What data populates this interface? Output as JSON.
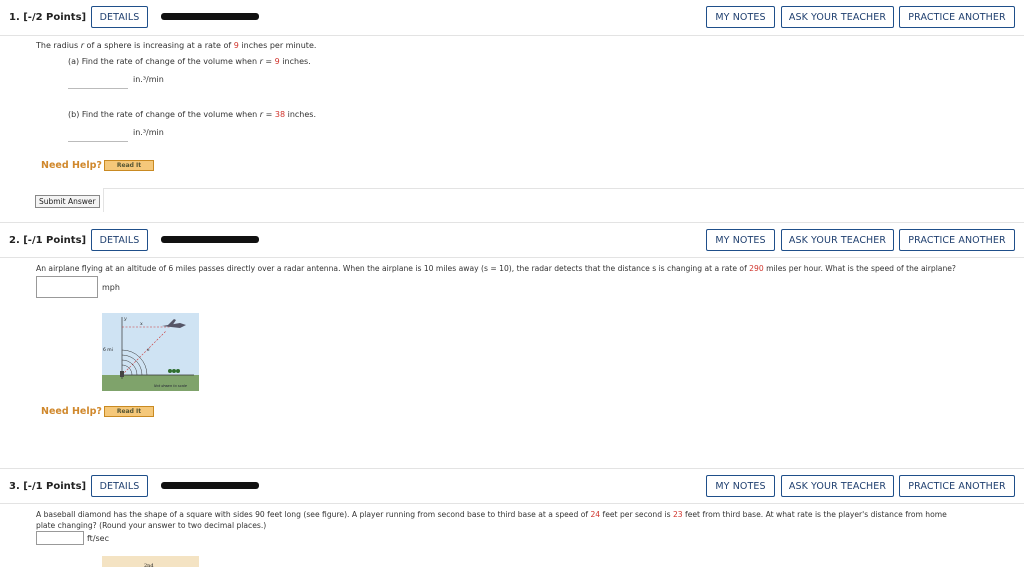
{
  "buttons": {
    "details": "DETAILS",
    "my_notes": "MY NOTES",
    "ask_teacher": "ASK YOUR TEACHER",
    "practice_another": "PRACTICE ANOTHER"
  },
  "q1": {
    "number": "1. [-/2 Points]",
    "prompt_pre": "The radius ",
    "prompt_var": "r",
    "prompt_mid": " of a sphere is increasing at a rate of ",
    "prompt_rate": "9",
    "prompt_post": " inches per minute.",
    "part_a_pre": "(a)  Find the rate of change of the volume when ",
    "part_a_var": "r",
    "part_a_eq": " = ",
    "part_a_val": "9",
    "part_a_post": " inches.",
    "unit_a": "in.³/min",
    "part_b_pre": "(b)  Find the rate of change of the volume when ",
    "part_b_var": "r",
    "part_b_eq": " = ",
    "part_b_val": "38",
    "part_b_post": " inches.",
    "unit_b": "in.³/min",
    "need_help": "Need Help?",
    "read_it": "Read It",
    "submit": "Submit Answer"
  },
  "q2": {
    "number": "2. [-/1 Points]",
    "prompt_pre": "An airplane flying at an altitude of 6 miles passes directly over a radar antenna. When the airplane is 10 miles away (s = 10), the radar detects that the distance s is changing at a rate of ",
    "prompt_rate": "290",
    "prompt_post": " miles per hour. What is the speed of the airplane?",
    "unit": "mph",
    "fig_height_label": "6 mi",
    "fig_x_label": "x",
    "fig_s_label": "s",
    "fig_y_label": "y",
    "fig_note": "Not drawn to scale",
    "need_help": "Need Help?",
    "read_it": "Read It"
  },
  "q3": {
    "number": "3. [-/1 Points]",
    "prompt_line1_pre": "A baseball diamond has the shape of a square with sides 90 feet long (see figure). A player running from second base to third base at a speed of ",
    "prompt_speed": "24",
    "prompt_line1_mid": " feet per second is ",
    "prompt_dist": "23",
    "prompt_line1_post": " feet from third base. At what rate is the player's distance from home",
    "prompt_line2": "plate changing? (Round your answer to two decimal places.)",
    "unit": "ft/sec",
    "fig_label": "2nd"
  }
}
